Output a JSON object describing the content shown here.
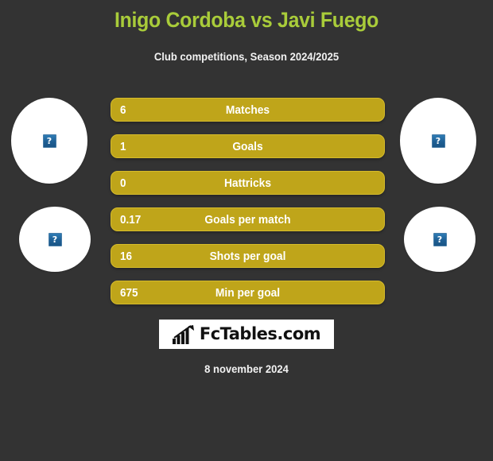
{
  "theme": {
    "background": "#333333",
    "title_color": "#A9CC3A",
    "bar_fill": "#BFA51A",
    "bar_border": "#D6BC2B",
    "text_color": "#FFFFFF"
  },
  "header": {
    "title": "Inigo Cordoba vs Javi Fuego",
    "subtitle": "Club competitions, Season 2024/2025"
  },
  "players": [
    {
      "position": "left-top",
      "photo_icon": "broken-image-icon",
      "placeholder_glyph": "?"
    },
    {
      "position": "right-top",
      "photo_icon": "broken-image-icon",
      "placeholder_glyph": "?"
    },
    {
      "position": "left-bottom",
      "photo_icon": "broken-image-icon",
      "placeholder_glyph": "?"
    },
    {
      "position": "right-bottom",
      "photo_icon": "broken-image-icon",
      "placeholder_glyph": "?"
    }
  ],
  "stats": [
    {
      "label": "Matches",
      "value": "6"
    },
    {
      "label": "Goals",
      "value": "1"
    },
    {
      "label": "Hattricks",
      "value": "0"
    },
    {
      "label": "Goals per match",
      "value": "0.17"
    },
    {
      "label": "Shots per goal",
      "value": "16"
    },
    {
      "label": "Min per goal",
      "value": "675"
    }
  ],
  "footer": {
    "logo_icon": "bar-chart-arrow-icon",
    "logo_text": "FcTables.com",
    "date": "8 november 2024"
  },
  "chart_data": {
    "type": "table",
    "title": "Inigo Cordoba vs Javi Fuego",
    "subtitle": "Club competitions, Season 2024/2025",
    "categories": [
      "Matches",
      "Goals",
      "Hattricks",
      "Goals per match",
      "Shots per goal",
      "Min per goal"
    ],
    "values": [
      6,
      1,
      0,
      0.17,
      16,
      675
    ],
    "value_labels": [
      "6",
      "1",
      "0",
      "0.17",
      "16",
      "675"
    ],
    "xlabel": "",
    "ylabel": "",
    "grid": false,
    "legend": "none",
    "annotations": [
      "8 november 2024",
      "FcTables.com"
    ]
  }
}
